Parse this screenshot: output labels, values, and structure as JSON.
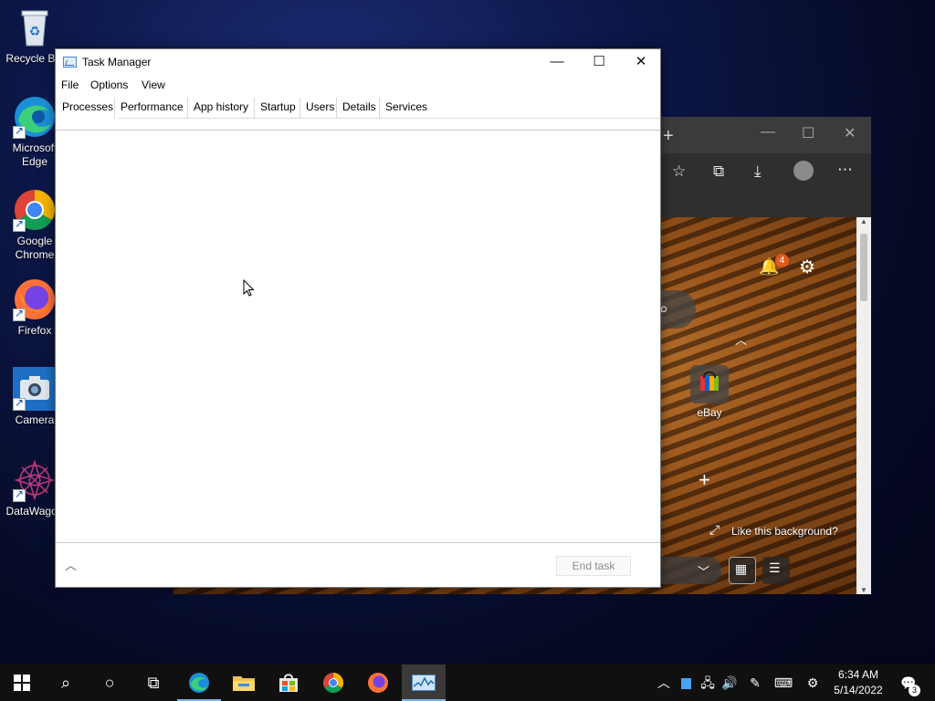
{
  "desktop": {
    "icons": [
      {
        "label": "Recycle Bin",
        "icon": "recycle-bin-icon"
      },
      {
        "label": "Microsoft Edge",
        "icon": "edge-icon"
      },
      {
        "label": "Google Chrome",
        "icon": "chrome-icon"
      },
      {
        "label": "Firefox",
        "icon": "firefox-icon"
      },
      {
        "label": "Camera",
        "icon": "camera-icon"
      },
      {
        "label": "DataWagon",
        "icon": "datawagon-icon"
      }
    ]
  },
  "edge": {
    "notification_count": "4",
    "tile_label": "eBay",
    "background_prompt": "Like this background?"
  },
  "task_manager": {
    "title": "Task Manager",
    "menu": {
      "file": "File",
      "options": "Options",
      "view": "View"
    },
    "tabs": [
      "Processes",
      "Performance",
      "App history",
      "Startup",
      "Users",
      "Details",
      "Services"
    ],
    "active_tab": "Processes",
    "end_task_label": "End task"
  },
  "taskbar": {
    "clock_time": "6:34 AM",
    "clock_date": "5/14/2022",
    "notification_count": "3"
  },
  "colors": {
    "taskbar_bg": "#101010",
    "accent": "#7fb2e8",
    "desktop_bg": "#0c1748"
  }
}
